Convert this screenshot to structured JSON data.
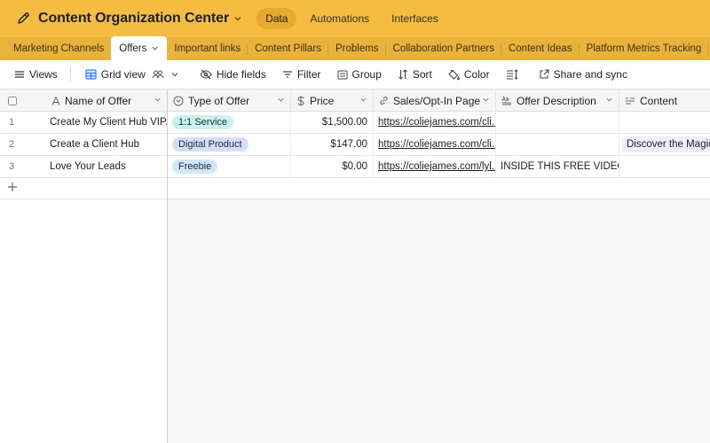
{
  "app": {
    "title": "Content Organization Center",
    "nav": [
      {
        "label": "Data",
        "active": true
      },
      {
        "label": "Automations",
        "active": false
      },
      {
        "label": "Interfaces",
        "active": false
      }
    ]
  },
  "tabs": [
    {
      "label": "Marketing Channels"
    },
    {
      "label": "Offers",
      "active": true
    },
    {
      "label": "Important links"
    },
    {
      "label": "Content Pillars"
    },
    {
      "label": "Problems"
    },
    {
      "label": "Collaboration Partners"
    },
    {
      "label": "Content Ideas"
    },
    {
      "label": "Platform Metrics Tracking"
    }
  ],
  "toolbar": {
    "views": "Views",
    "grid_view": "Grid view",
    "hide_fields": "Hide fields",
    "filter": "Filter",
    "group": "Group",
    "sort": "Sort",
    "color": "Color",
    "share": "Share and sync"
  },
  "columns": [
    {
      "label": "Name of Offer",
      "icon": "text-icon"
    },
    {
      "label": "Type of Offer",
      "icon": "single-select-icon"
    },
    {
      "label": "Price",
      "icon": "currency-icon"
    },
    {
      "label": "Sales/Opt-In Page",
      "icon": "link-icon"
    },
    {
      "label": "Offer Description",
      "icon": "long-text-icon"
    },
    {
      "label": "Content",
      "icon": "linked-record-icon"
    }
  ],
  "rows": [
    {
      "num": "1",
      "name": "Create My Client Hub VIP...",
      "type": "1:1 Service",
      "type_color": "#c9f2ec",
      "price": "$1,500.00",
      "page": "https://coliejames.com/cli...",
      "description": "",
      "content": ""
    },
    {
      "num": "2",
      "name": "Create a Client Hub",
      "type": "Digital Product",
      "type_color": "#d4def9",
      "price": "$147.00",
      "page": "https://coliejames.com/cli...",
      "description": "",
      "content": "Discover the Magic c"
    },
    {
      "num": "3",
      "name": "Love Your Leads",
      "type": "Freebie",
      "type_color": "#cfe9fb",
      "price": "$0.00",
      "page": "https://coliejames.com/lyl...",
      "description": "INSIDE THIS FREE VIDEO ...",
      "content": ""
    }
  ]
}
